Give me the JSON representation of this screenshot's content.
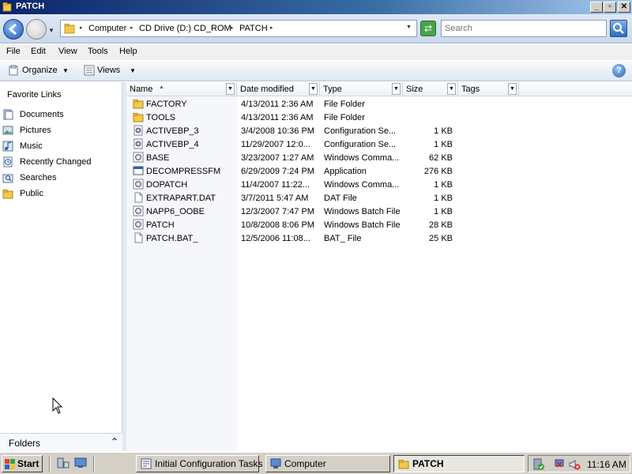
{
  "window": {
    "title": "PATCH",
    "controls": {
      "minimize": "_",
      "maximize": "▫",
      "close": "✕"
    }
  },
  "address_bar": {
    "crumbs": [
      "Computer",
      "CD Drive (D:) CD_ROM",
      "PATCH"
    ],
    "search_placeholder": "Search"
  },
  "menu": [
    "File",
    "Edit",
    "View",
    "Tools",
    "Help"
  ],
  "toolbar": {
    "organize_label": "Organize",
    "views_label": "Views",
    "help_label": "?"
  },
  "navigation_pane": {
    "header": "Favorite Links",
    "links": [
      {
        "label": "Documents",
        "icon": "documents-icon"
      },
      {
        "label": "Pictures",
        "icon": "pictures-icon"
      },
      {
        "label": "Music",
        "icon": "music-icon"
      },
      {
        "label": "Recently Changed",
        "icon": "recently-changed-icon"
      },
      {
        "label": "Searches",
        "icon": "searches-icon"
      },
      {
        "label": "Public",
        "icon": "public-folder-icon"
      }
    ],
    "folders_label": "Folders"
  },
  "file_list": {
    "columns": [
      "Name",
      "Date modified",
      "Type",
      "Size",
      "Tags"
    ],
    "rows": [
      {
        "name": "FACTORY",
        "date": "4/13/2011 2:36 AM",
        "type": "File Folder",
        "size": "",
        "icon": "folder"
      },
      {
        "name": "TOOLS",
        "date": "4/13/2011 2:36 AM",
        "type": "File Folder",
        "size": "",
        "icon": "folder"
      },
      {
        "name": "ACTIVEBP_3",
        "date": "3/4/2008 10:36 PM",
        "type": "Configuration Se...",
        "size": "1 KB",
        "icon": "config"
      },
      {
        "name": "ACTIVEBP_4",
        "date": "11/29/2007 12:0...",
        "type": "Configuration Se...",
        "size": "1 KB",
        "icon": "config"
      },
      {
        "name": "BASE",
        "date": "3/23/2007 1:27 AM",
        "type": "Windows Comma...",
        "size": "62 KB",
        "icon": "batch"
      },
      {
        "name": "DECOMPRESSFM",
        "date": "6/29/2009 7:24 PM",
        "type": "Application",
        "size": "276 KB",
        "icon": "application"
      },
      {
        "name": "DOPATCH",
        "date": "11/4/2007 11:22...",
        "type": "Windows Comma...",
        "size": "1 KB",
        "icon": "batch"
      },
      {
        "name": "EXTRAPART.DAT",
        "date": "3/7/2011 5:47 AM",
        "type": "DAT File",
        "size": "1 KB",
        "icon": "file"
      },
      {
        "name": "NAPP6_OOBE",
        "date": "12/3/2007 7:47 PM",
        "type": "Windows Batch File",
        "size": "1 KB",
        "icon": "batch"
      },
      {
        "name": "PATCH",
        "date": "10/8/2008 8:06 PM",
        "type": "Windows Batch File",
        "size": "28 KB",
        "icon": "batch"
      },
      {
        "name": "PATCH.BAT_",
        "date": "12/5/2006 11:08...",
        "type": "BAT_ File",
        "size": "25 KB",
        "icon": "file"
      }
    ]
  },
  "taskbar": {
    "start_label": "Start",
    "buttons": [
      {
        "label": "Initial Configuration Tasks",
        "active": false
      },
      {
        "label": "Computer",
        "active": false
      },
      {
        "label": "PATCH",
        "active": true
      }
    ],
    "clock": "11:16 AM"
  },
  "colors": {
    "title_start": "#0a246a",
    "title_end": "#a6caf0",
    "folder": "#f2c94c",
    "taskbar": "#d4d0c8"
  }
}
